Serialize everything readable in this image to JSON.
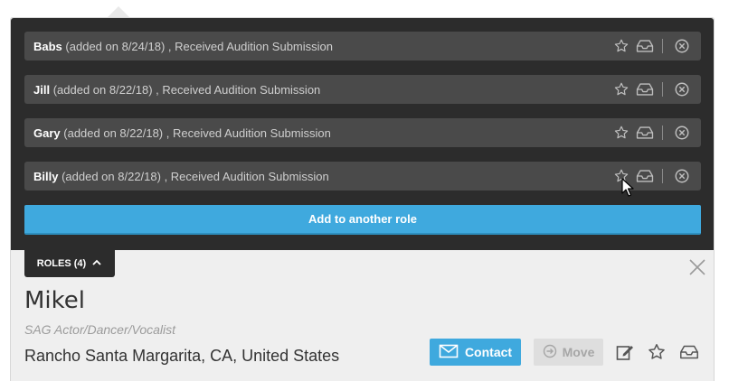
{
  "roles_panel": {
    "rows": [
      {
        "name": "Babs",
        "detail": "(added on 8/24/18) , Received Audition Submission"
      },
      {
        "name": "Jill",
        "detail": "(added on 8/22/18) , Received Audition Submission"
      },
      {
        "name": "Gary",
        "detail": "(added on 8/22/18) , Received Audition Submission"
      },
      {
        "name": "Billy",
        "detail": "(added on 8/22/18) , Received Audition Submission"
      }
    ],
    "row_icons": [
      "star-outline-icon",
      "inbox-tray-icon",
      "circle-x-icon"
    ],
    "add_role_label": "Add to another role"
  },
  "roles_tab": {
    "label": "ROLES (4)",
    "icon": "chevron-up-icon"
  },
  "profile": {
    "name": "Mikel",
    "subtitle": "SAG Actor/Dancer/Vocalist",
    "location": "Rancho Santa Margarita, CA, United States"
  },
  "actions": {
    "contact_label": "Contact",
    "contact_icon": "envelope-icon",
    "move_label": "Move",
    "move_icon": "circle-arrow-icon",
    "extra_icons": [
      "edit-note-icon",
      "star-outline-icon",
      "inbox-tray-icon"
    ]
  },
  "colors": {
    "panel_bg": "#2c2c2c",
    "row_bg": "#4a4a4a",
    "accent": "#3fa9de",
    "card_bg": "#efefef"
  }
}
